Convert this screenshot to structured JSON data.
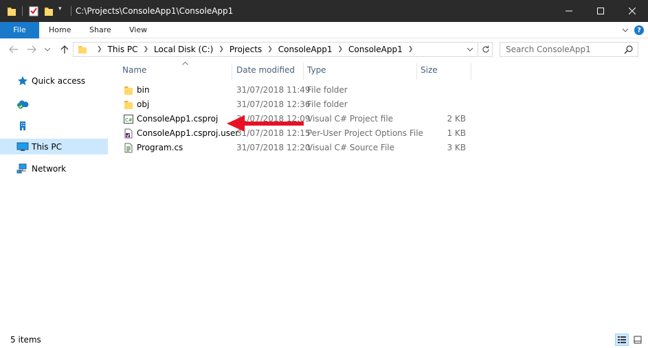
{
  "window": {
    "title": "C:\\Projects\\ConsoleApp1\\ConsoleApp1",
    "controls": {
      "minimize": "—",
      "maximize": "☐",
      "close": "✕"
    }
  },
  "ribbon": {
    "tabs": [
      "File",
      "Home",
      "Share",
      "View"
    ],
    "expand_icon": "chevron-down",
    "help": "?"
  },
  "address": {
    "crumbs": [
      "This PC",
      "Local Disk (C:)",
      "Projects",
      "ConsoleApp1",
      "ConsoleApp1"
    ]
  },
  "search": {
    "placeholder": "Search ConsoleApp1"
  },
  "nav_pane": {
    "items": [
      {
        "label": "Quick access",
        "icon": "star-icon"
      },
      {
        "label": "",
        "icon": "onedrive-icon"
      },
      {
        "label": "",
        "icon": "building-icon"
      },
      {
        "label": "This PC",
        "icon": "monitor-icon",
        "selected": true
      },
      {
        "label": "Network",
        "icon": "network-icon"
      }
    ]
  },
  "columns": {
    "name": "Name",
    "date": "Date modified",
    "type": "Type",
    "size": "Size"
  },
  "files": [
    {
      "name": "bin",
      "date": "31/07/2018 11:49",
      "type": "File folder",
      "size": "",
      "icon": "folder-icon"
    },
    {
      "name": "obj",
      "date": "31/07/2018 12:36",
      "type": "File folder",
      "size": "",
      "icon": "folder-icon"
    },
    {
      "name": "ConsoleApp1.csproj",
      "date": "31/07/2018 12:09",
      "type": "Visual C# Project file",
      "size": "2 KB",
      "icon": "csproj-icon"
    },
    {
      "name": "ConsoleApp1.csproj.user",
      "date": "31/07/2018 12:15",
      "type": "Per-User Project Options File",
      "size": "1 KB",
      "icon": "user-file-icon"
    },
    {
      "name": "Program.cs",
      "date": "31/07/2018 12:20",
      "type": "Visual C# Source File",
      "size": "3 KB",
      "icon": "cs-file-icon"
    }
  ],
  "annotation": {
    "arrow_color": "#e81123"
  },
  "status": {
    "items_text": "5 items"
  },
  "colors": {
    "accent": "#1979ca",
    "selection": "#cce8ff",
    "titlebar": "#2b2b2b"
  }
}
